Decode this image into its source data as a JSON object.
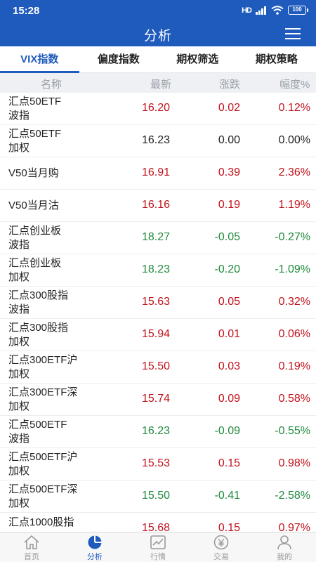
{
  "status_bar": {
    "time": "15:28",
    "signal": "HD",
    "battery": "100"
  },
  "header": {
    "title": "分析"
  },
  "tabs": [
    {
      "label": "VIX指数",
      "active": true
    },
    {
      "label": "偏度指数",
      "active": false
    },
    {
      "label": "期权筛选",
      "active": false
    },
    {
      "label": "期权策略",
      "active": false
    }
  ],
  "table": {
    "columns": {
      "name": "名称",
      "last": "最新",
      "change": "涨跌",
      "pct": "幅度%"
    },
    "rows": [
      {
        "name1": "汇点50ETF",
        "name2": "波指",
        "last": "16.20",
        "change": "0.02",
        "pct": "0.12%",
        "dir": "up"
      },
      {
        "name1": "汇点50ETF",
        "name2": "加权",
        "last": "16.23",
        "change": "0.00",
        "pct": "0.00%",
        "dir": "flat"
      },
      {
        "name1": "V50当月购",
        "name2": "",
        "last": "16.91",
        "change": "0.39",
        "pct": "2.36%",
        "dir": "up"
      },
      {
        "name1": "V50当月沽",
        "name2": "",
        "last": "16.16",
        "change": "0.19",
        "pct": "1.19%",
        "dir": "up"
      },
      {
        "name1": "汇点创业板",
        "name2": "波指",
        "last": "18.27",
        "change": "-0.05",
        "pct": "-0.27%",
        "dir": "down"
      },
      {
        "name1": "汇点创业板",
        "name2": "加权",
        "last": "18.23",
        "change": "-0.20",
        "pct": "-1.09%",
        "dir": "down"
      },
      {
        "name1": "汇点300股指",
        "name2": "波指",
        "last": "15.63",
        "change": "0.05",
        "pct": "0.32%",
        "dir": "up"
      },
      {
        "name1": "汇点300股指",
        "name2": "加权",
        "last": "15.94",
        "change": "0.01",
        "pct": "0.06%",
        "dir": "up"
      },
      {
        "name1": "汇点300ETF沪",
        "name2": "加权",
        "last": "15.50",
        "change": "0.03",
        "pct": "0.19%",
        "dir": "up"
      },
      {
        "name1": "汇点300ETF深",
        "name2": "加权",
        "last": "15.74",
        "change": "0.09",
        "pct": "0.58%",
        "dir": "up"
      },
      {
        "name1": "汇点500ETF",
        "name2": "波指",
        "last": "16.23",
        "change": "-0.09",
        "pct": "-0.55%",
        "dir": "down"
      },
      {
        "name1": "汇点500ETF沪",
        "name2": "加权",
        "last": "15.53",
        "change": "0.15",
        "pct": "0.98%",
        "dir": "up"
      },
      {
        "name1": "汇点500ETF深",
        "name2": "加权",
        "last": "15.50",
        "change": "-0.41",
        "pct": "-2.58%",
        "dir": "down"
      },
      {
        "name1": "汇点1000股指",
        "name2": "",
        "last": "15.68",
        "change": "0.15",
        "pct": "0.97%",
        "dir": "up"
      }
    ]
  },
  "bottom_nav": [
    {
      "label": "首页",
      "icon": "home-icon",
      "active": false
    },
    {
      "label": "分析",
      "icon": "pie-chart-icon",
      "active": true
    },
    {
      "label": "行情",
      "icon": "line-chart-icon",
      "active": false
    },
    {
      "label": "交易",
      "icon": "yen-icon",
      "active": false
    },
    {
      "label": "我的",
      "icon": "user-icon",
      "active": false
    }
  ],
  "colors": {
    "primary": "#1f5bbd",
    "up": "#c0111b",
    "down": "#1f8a3d",
    "flat": "#222222",
    "header_bg": "#eef0f3"
  }
}
